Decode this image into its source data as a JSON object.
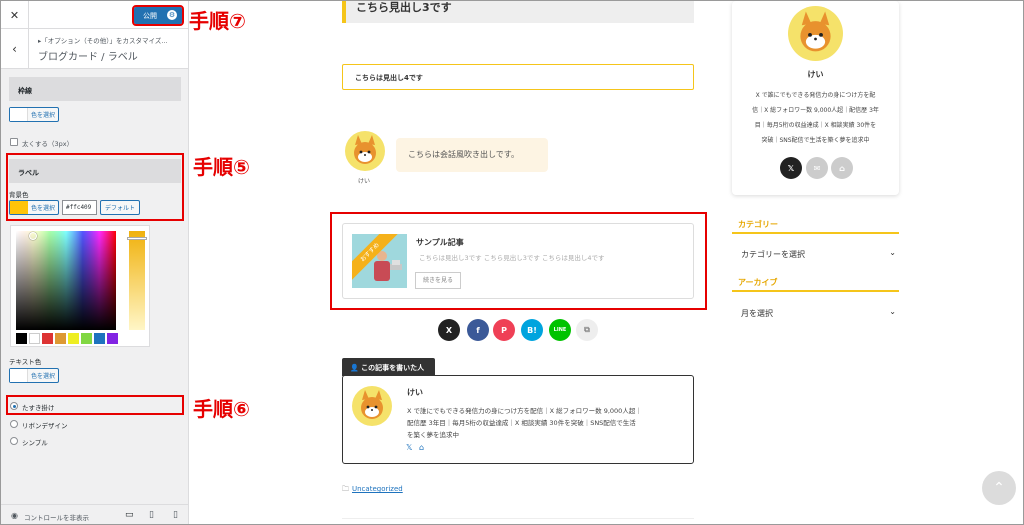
{
  "customizer": {
    "close_glyph": "✕",
    "publish_label": "公開",
    "back_glyph": "‹",
    "breadcrumb": "▸「オプション（その他）」をカスタマイズ...",
    "section_title": "ブログカード / ラベル",
    "group_border": "枠線",
    "color_select": "色を選択",
    "thick_label": "太くする（3px）",
    "group_label": "ラベル",
    "bg_color_label": "背景色",
    "hex_value": "#ffc409",
    "default_label": "デフォルト",
    "text_color_label": "テキスト色",
    "radio_options": [
      "たすき掛け",
      "リボンデザイン",
      "シンプル"
    ],
    "hide_controls": "コントロールを非表示",
    "palette": [
      "#000000",
      "#ffffff",
      "#dd3333",
      "#dd9933",
      "#eeee22",
      "#81d742",
      "#1e73be",
      "#8224e3"
    ],
    "accent_color": "#ffc409"
  },
  "annotations": {
    "step7": "手順⑦",
    "step5": "手順⑤",
    "step6": "手順⑥"
  },
  "preview": {
    "heading3": "こちら見出し3です",
    "heading4": "こちらは見出し4です",
    "speech_name": "けい",
    "speech_text": "こちらは会話風吹き出しです。",
    "card_ribbon": "おすすめ",
    "card_title": "サンプル記事",
    "card_excerpt": "こちらは見出し3です こちら見出し3です こちらは見出し4です",
    "card_more": "続きを見る",
    "share_labels": [
      "X",
      "f",
      "P",
      "B!",
      "LINE",
      "⧉"
    ],
    "author_tag": "この記事を書いた人",
    "author_name": "けい",
    "author_bio_1": "X で誰にでもできる発信力の身につけ方を配信｜X 総フォロワー数 9,000人超｜",
    "author_bio_2": "配信歴 3年目｜毎月5桁の収益達成｜X 相談実績 30件を突破｜SNS配信で生活",
    "author_bio_3": "を築く夢を追求中",
    "category_link": "Uncategorized"
  },
  "sidebar": {
    "profile_name": "けい",
    "profile_bio_1": "X で誰にでもできる発信力の身につけ方を配",
    "profile_bio_2": "信｜X 総フォロワー数 9,000人超｜配信歴 3年",
    "profile_bio_3": "目｜毎月5桁の収益達成｜X 相談実績 30件を",
    "profile_bio_4": "突破｜SNS配信で生活を築く夢を追求中",
    "category_title": "カテゴリー",
    "category_select": "カテゴリーを選択",
    "archive_title": "アーカイブ",
    "archive_select": "月を選択"
  }
}
